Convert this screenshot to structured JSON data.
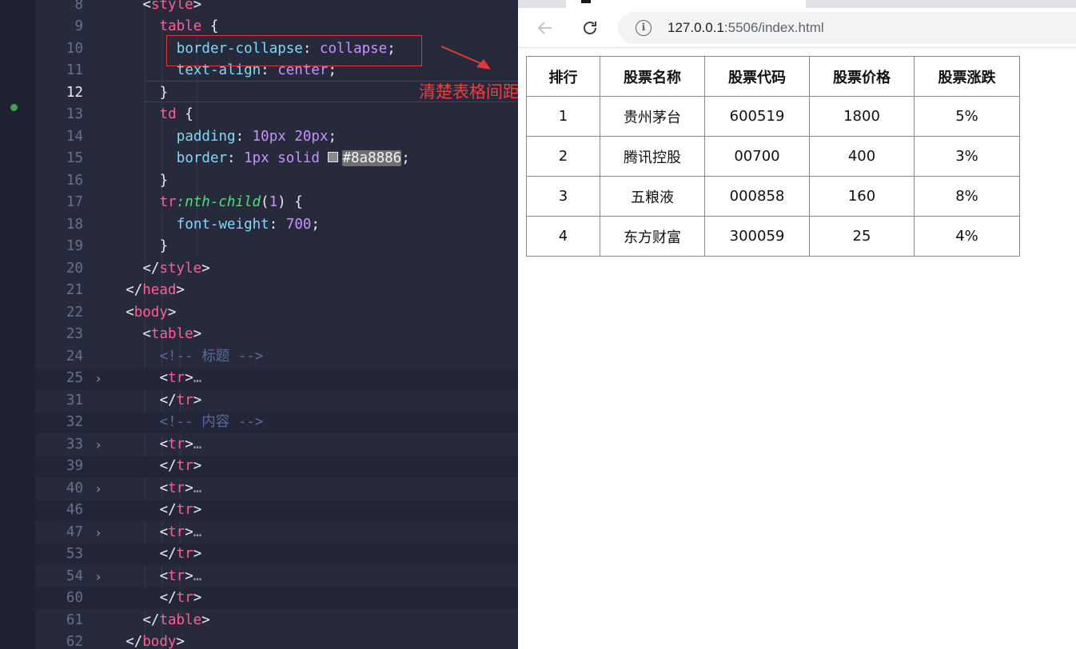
{
  "editor": {
    "lines": [
      {
        "num": "8",
        "tokens": [
          [
            "t-punc",
            "<"
          ],
          [
            "t-tag",
            "style"
          ],
          [
            "t-punc",
            ">"
          ]
        ]
      },
      {
        "num": "9",
        "tokens": [
          [
            "t-sel",
            "table"
          ],
          [
            "t-punc",
            " {"
          ]
        ]
      },
      {
        "num": "10",
        "tokens": [
          [
            "t-prop",
            "border-collapse"
          ],
          [
            "t-punc",
            ": "
          ],
          [
            "t-val",
            "collapse"
          ],
          [
            "t-punc",
            ";"
          ]
        ]
      },
      {
        "num": "11",
        "tokens": [
          [
            "t-prop",
            "text-align"
          ],
          [
            "t-punc",
            ": "
          ],
          [
            "t-val",
            "center"
          ],
          [
            "t-punc",
            ";"
          ]
        ]
      },
      {
        "num": "12",
        "tokens": [
          [
            "t-punc",
            "}"
          ]
        ]
      },
      {
        "num": "13",
        "tokens": [
          [
            "t-sel",
            "td"
          ],
          [
            "t-punc",
            " {"
          ]
        ]
      },
      {
        "num": "14",
        "tokens": [
          [
            "t-prop",
            "padding"
          ],
          [
            "t-punc",
            ": "
          ],
          [
            "t-num",
            "10px 20px"
          ],
          [
            "t-punc",
            ";"
          ]
        ]
      },
      {
        "num": "15",
        "tokens": [
          [
            "t-prop",
            "border"
          ],
          [
            "t-punc",
            ": "
          ],
          [
            "t-num",
            "1px "
          ],
          [
            "t-val",
            "solid "
          ]
        ]
      },
      {
        "num": "16",
        "tokens": [
          [
            "t-punc",
            "}"
          ]
        ]
      },
      {
        "num": "17",
        "tokens": [
          [
            "t-sel",
            "tr"
          ],
          [
            "t-fn",
            ":nth-child"
          ],
          [
            "t-punc",
            "("
          ],
          [
            "t-num",
            "1"
          ],
          [
            "t-punc",
            ") {"
          ]
        ]
      },
      {
        "num": "18",
        "tokens": [
          [
            "t-prop",
            "font-weight"
          ],
          [
            "t-punc",
            ": "
          ],
          [
            "t-num",
            "700"
          ],
          [
            "t-punc",
            ";"
          ]
        ]
      },
      {
        "num": "19",
        "tokens": [
          [
            "t-punc",
            "}"
          ]
        ]
      },
      {
        "num": "20",
        "tokens": [
          [
            "t-punc",
            "</"
          ],
          [
            "t-tag",
            "style"
          ],
          [
            "t-punc",
            ">"
          ]
        ]
      },
      {
        "num": "21",
        "tokens": [
          [
            "t-punc",
            "</"
          ],
          [
            "t-tag",
            "head"
          ],
          [
            "t-punc",
            ">"
          ]
        ]
      },
      {
        "num": "22",
        "tokens": [
          [
            "t-punc",
            "<"
          ],
          [
            "t-tag",
            "body"
          ],
          [
            "t-punc",
            ">"
          ]
        ]
      },
      {
        "num": "23",
        "tokens": [
          [
            "t-punc",
            "<"
          ],
          [
            "t-tag",
            "table"
          ],
          [
            "t-punc",
            ">"
          ]
        ]
      },
      {
        "num": "24",
        "tokens": [
          [
            "t-cmt",
            "<!-- 标题 -->"
          ]
        ]
      },
      {
        "num": "25",
        "tokens": [
          [
            "t-punc",
            "<"
          ],
          [
            "t-tag",
            "tr"
          ],
          [
            "t-punc",
            ">"
          ],
          [
            "t-fold",
            "…"
          ]
        ]
      },
      {
        "num": "31",
        "tokens": [
          [
            "t-punc",
            "</"
          ],
          [
            "t-tag",
            "tr"
          ],
          [
            "t-punc",
            ">"
          ]
        ]
      },
      {
        "num": "32",
        "tokens": [
          [
            "t-cmt",
            "<!-- 内容 -->"
          ]
        ]
      },
      {
        "num": "33",
        "tokens": [
          [
            "t-punc",
            "<"
          ],
          [
            "t-tag",
            "tr"
          ],
          [
            "t-punc",
            ">"
          ],
          [
            "t-fold",
            "…"
          ]
        ]
      },
      {
        "num": "39",
        "tokens": [
          [
            "t-punc",
            "</"
          ],
          [
            "t-tag",
            "tr"
          ],
          [
            "t-punc",
            ">"
          ]
        ]
      },
      {
        "num": "40",
        "tokens": [
          [
            "t-punc",
            "<"
          ],
          [
            "t-tag",
            "tr"
          ],
          [
            "t-punc",
            ">"
          ],
          [
            "t-fold",
            "…"
          ]
        ]
      },
      {
        "num": "46",
        "tokens": [
          [
            "t-punc",
            "</"
          ],
          [
            "t-tag",
            "tr"
          ],
          [
            "t-punc",
            ">"
          ]
        ]
      },
      {
        "num": "47",
        "tokens": [
          [
            "t-punc",
            "<"
          ],
          [
            "t-tag",
            "tr"
          ],
          [
            "t-punc",
            ">"
          ],
          [
            "t-fold",
            "…"
          ]
        ]
      },
      {
        "num": "53",
        "tokens": [
          [
            "t-punc",
            "</"
          ],
          [
            "t-tag",
            "tr"
          ],
          [
            "t-punc",
            ">"
          ]
        ]
      },
      {
        "num": "54",
        "tokens": [
          [
            "t-punc",
            "<"
          ],
          [
            "t-tag",
            "tr"
          ],
          [
            "t-punc",
            ">"
          ],
          [
            "t-fold",
            "…"
          ]
        ]
      },
      {
        "num": "60",
        "tokens": [
          [
            "t-punc",
            "</"
          ],
          [
            "t-tag",
            "tr"
          ],
          [
            "t-punc",
            ">"
          ]
        ]
      },
      {
        "num": "61",
        "tokens": [
          [
            "t-punc",
            "</"
          ],
          [
            "t-tag",
            "table"
          ],
          [
            "t-punc",
            ">"
          ]
        ]
      },
      {
        "num": "62",
        "tokens": [
          [
            "t-punc",
            "</"
          ],
          [
            "t-tag",
            "body"
          ],
          [
            "t-punc",
            ">"
          ]
        ]
      }
    ],
    "border_color_value": "#8a8886",
    "swatch_color": "#8a8886",
    "annotation_label": "清楚表格间距",
    "annotation_color": "#e23a3a"
  },
  "browser": {
    "url_host": "127.0.0.1",
    "url_rest": ":5506/index.html",
    "back_icon": "arrow-left-icon",
    "reload_icon": "reload-icon",
    "info_icon": "info-icon"
  },
  "stock_table": {
    "headers": [
      "排行",
      "股票名称",
      "股票代码",
      "股票价格",
      "股票涨跌"
    ],
    "rows": [
      [
        "1",
        "贵州茅台",
        "600519",
        "1800",
        "5%"
      ],
      [
        "2",
        "腾讯控股",
        "00700",
        "400",
        "3%"
      ],
      [
        "3",
        "五粮液",
        "000858",
        "160",
        "8%"
      ],
      [
        "4",
        "东方财富",
        "300059",
        "25",
        "4%"
      ]
    ]
  }
}
